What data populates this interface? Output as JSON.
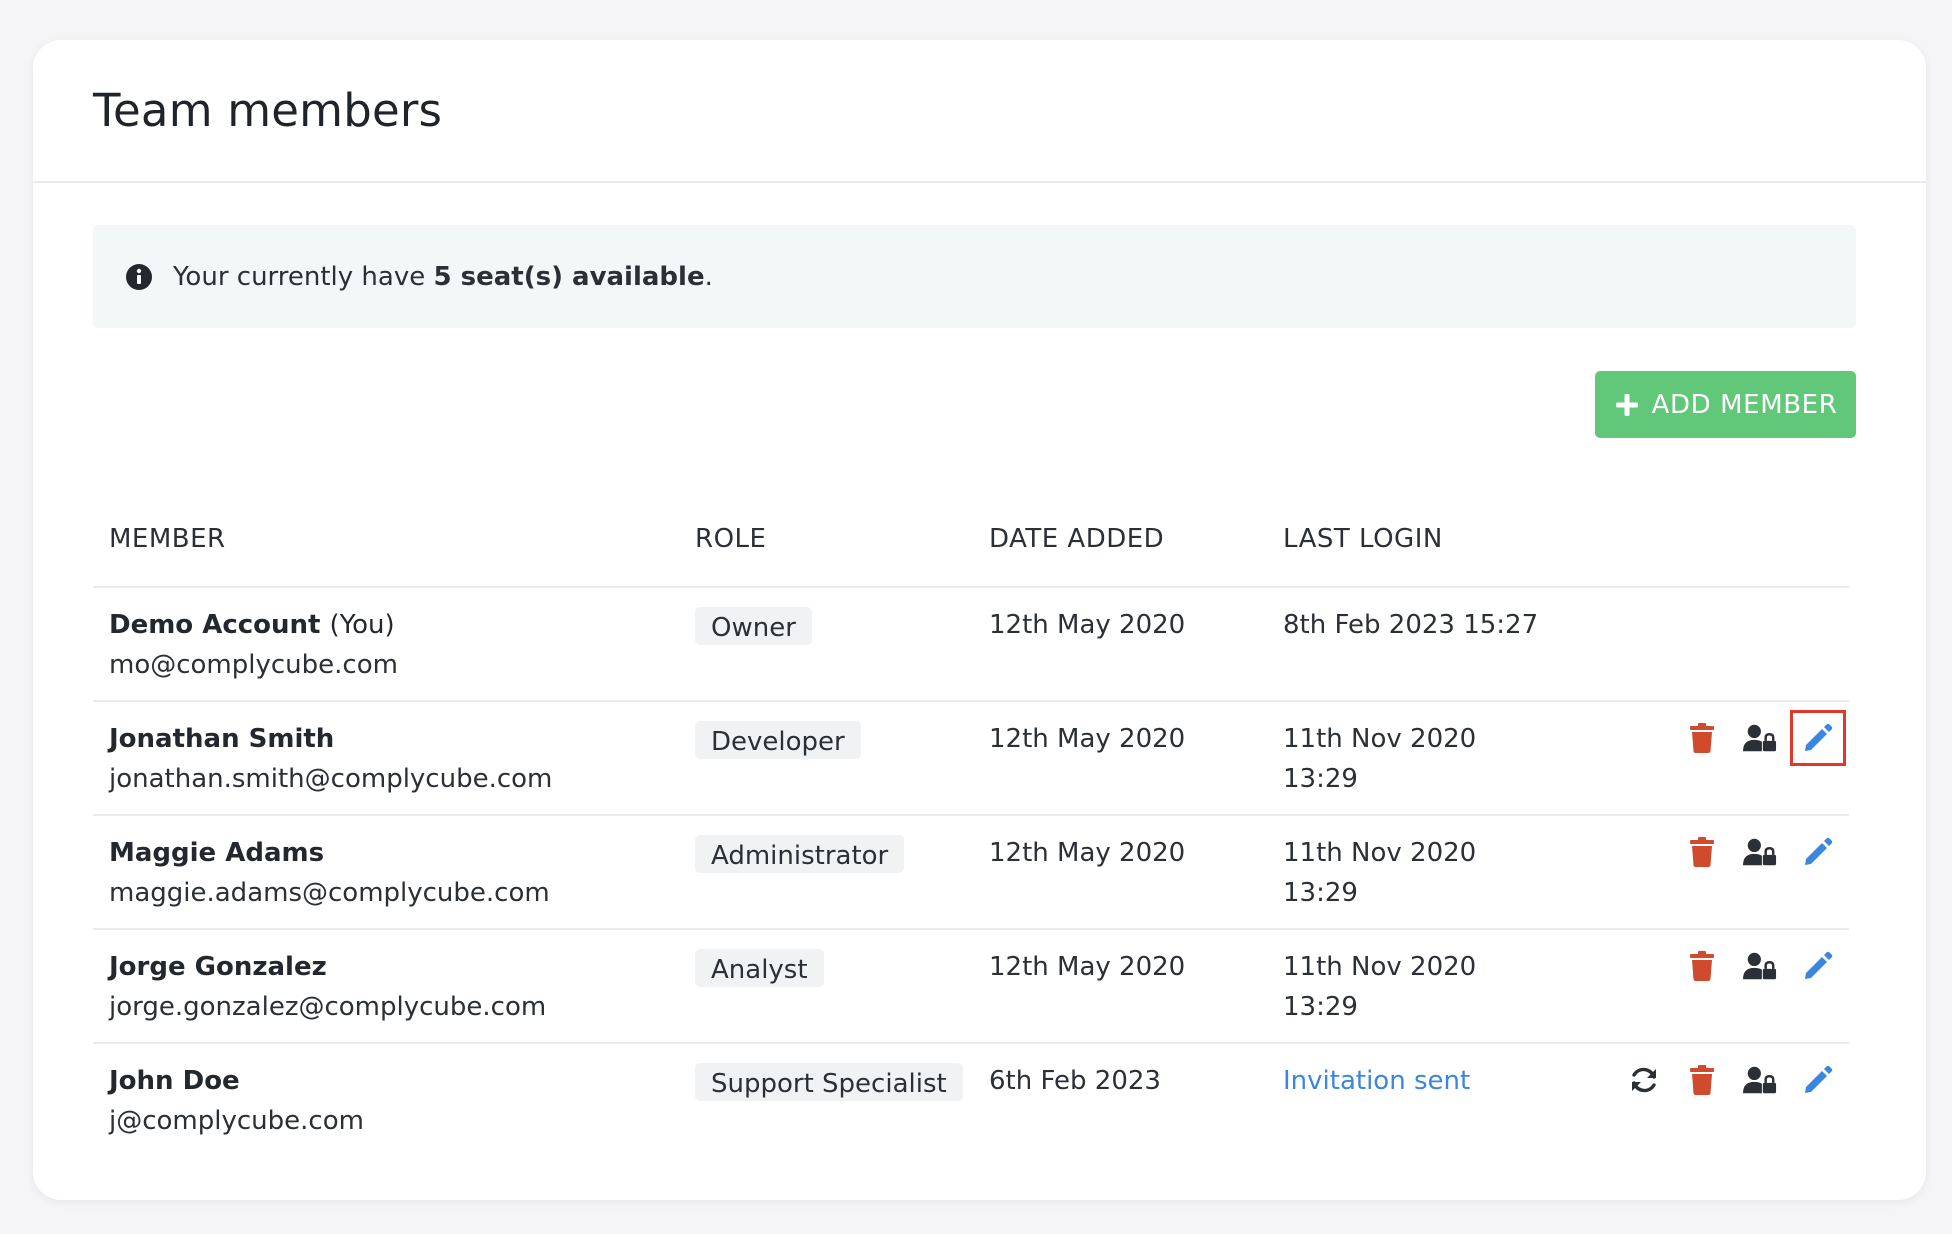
{
  "header": {
    "title": "Team members"
  },
  "notice": {
    "prefix": "Your currently have ",
    "emphasis": "5 seat(s) available",
    "suffix": "."
  },
  "toolbar": {
    "add_member_label": "ADD MEMBER"
  },
  "table": {
    "columns": {
      "member": "MEMBER",
      "role": "ROLE",
      "date_added": "DATE ADDED",
      "last_login": "LAST LOGIN"
    },
    "rows": [
      {
        "name": "Demo Account",
        "you_label": "(You)",
        "email": "mo@complycube.com",
        "role": "Owner",
        "date_added": "12th May 2020",
        "last_login_line1": "8th Feb 2023 15:27",
        "last_login_line2": ""
      },
      {
        "name": "Jonathan Smith",
        "email": "jonathan.smith@complycube.com",
        "role": "Developer",
        "date_added": "12th May 2020",
        "last_login_line1": "11th Nov 2020",
        "last_login_line2": "13:29"
      },
      {
        "name": "Maggie Adams",
        "email": "maggie.adams@complycube.com",
        "role": "Administrator",
        "date_added": "12th May 2020",
        "last_login_line1": "11th Nov 2020",
        "last_login_line2": "13:29"
      },
      {
        "name": "Jorge Gonzalez",
        "email": "jorge.gonzalez@complycube.com",
        "role": "Analyst",
        "date_added": "12th May 2020",
        "last_login_line1": "11th Nov 2020",
        "last_login_line2": "13:29"
      },
      {
        "name": "John Doe",
        "email": "j@complycube.com",
        "role": "Support Specialist",
        "date_added": "6th Feb 2023",
        "status": "Invitation sent"
      }
    ]
  },
  "colors": {
    "accent_green": "#62c879",
    "delete_red": "#d04a2e",
    "edit_blue": "#3a86e0",
    "highlight_red": "#e0392b",
    "link_blue": "#3a86e0"
  },
  "icons": {
    "notice": "info-icon",
    "add": "plus-icon",
    "delete": "trash-icon",
    "permissions": "user-lock-icon",
    "edit": "pencil-icon",
    "resend": "refresh-icon"
  }
}
